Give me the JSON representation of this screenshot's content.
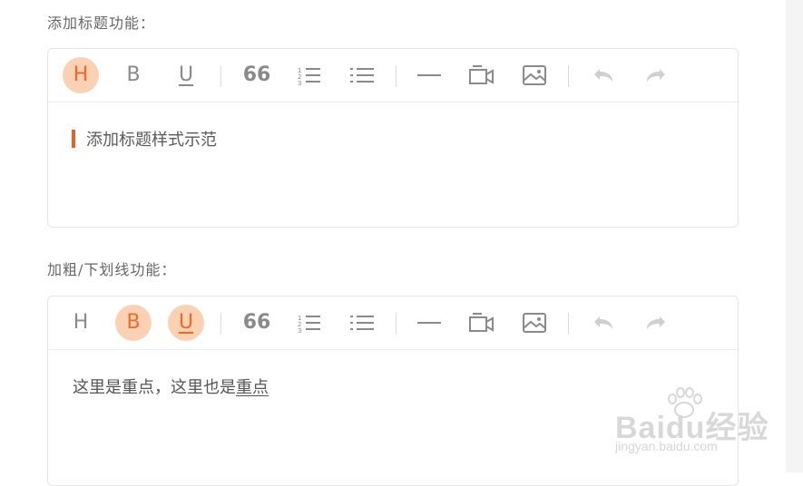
{
  "sections": [
    {
      "label": "添加标题功能：",
      "toolbar": {
        "heading": "H",
        "bold": "B",
        "underline": "U",
        "quote": "66"
      },
      "active": [
        "heading"
      ],
      "content": {
        "heading_text": "添加标题样式示范"
      }
    },
    {
      "label": "加粗/下划线功能：",
      "toolbar": {
        "heading": "H",
        "bold": "B",
        "underline": "U",
        "quote": "66"
      },
      "active": [
        "bold",
        "underline"
      ],
      "content": {
        "text_plain": "这里是重点，这里也是",
        "text_underlined": "重点"
      }
    }
  ],
  "icons": [
    "heading-icon",
    "bold-icon",
    "underline-icon",
    "quote-icon",
    "ordered-list-icon",
    "unordered-list-icon",
    "horizontal-rule-icon",
    "video-icon",
    "image-icon",
    "undo-icon",
    "redo-icon"
  ],
  "colors": {
    "accent": "#ef6a2a",
    "active_bg": "#fbd1b4",
    "heading_mark": "#ee5e22"
  },
  "watermark": {
    "brand": "Baidu经验",
    "url": "jingyan.baidu.com"
  }
}
